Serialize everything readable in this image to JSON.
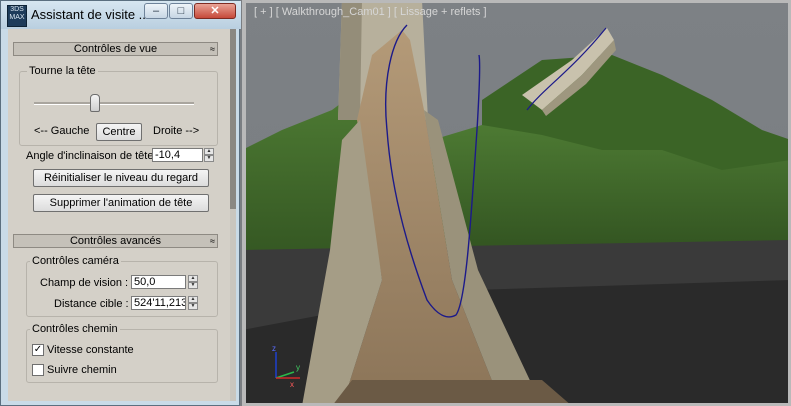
{
  "dialog": {
    "title": "Assistant de visite ...",
    "app_logo": "3DS MAX",
    "window_buttons": {
      "minimize": "–",
      "maximize": "□",
      "close": "✕"
    }
  },
  "view_controls": {
    "header": "Contrôles de vue",
    "collapse_symbol": "≈",
    "head_turn_group": "Tourne la tête",
    "head_turn_slider_value": 0.38,
    "left_label": "<-- Gauche",
    "center_button": "Centre",
    "right_label": "Droite -->",
    "tilt_label": "Angle d'inclinaison de tête",
    "tilt_value": "-10,4",
    "reset_button": "Réinitialiser le niveau du regard",
    "delete_button": "Supprimer l'animation de tête"
  },
  "advanced_controls": {
    "header": "Contrôles avancés",
    "collapse_symbol": "≈",
    "camera_group": "Contrôles caméra",
    "fov_label": "Champ de vision :",
    "fov_value": "50,0",
    "target_label": "Distance cible :",
    "target_value": "524'11,213",
    "path_group": "Contrôles chemin",
    "constant_speed_label": "Vitesse constante",
    "constant_speed_checked": true,
    "follow_path_label": "Suivre chemin",
    "follow_path_checked": false
  },
  "viewport": {
    "label": "[ + ] [ Walkthrough_Cam01 ] [ Lissage + reflets ]",
    "axis_labels": {
      "z": "z",
      "y": "y",
      "x": "x"
    }
  }
}
